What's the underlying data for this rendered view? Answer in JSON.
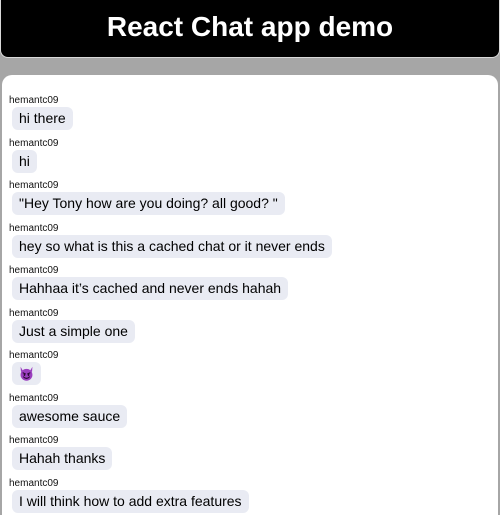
{
  "header": {
    "title": "React Chat app demo"
  },
  "messages": [
    {
      "author": "hemantc09",
      "text": "hi there"
    },
    {
      "author": "hemantc09",
      "text": "hi"
    },
    {
      "author": "hemantc09",
      "text": "\"Hey Tony how are you doing? all good? \""
    },
    {
      "author": "hemantc09",
      "text": "hey so what is this a cached chat or it never ends"
    },
    {
      "author": "hemantc09",
      "text": "Hahhaa it’s cached and never ends hahah"
    },
    {
      "author": "hemantc09",
      "text": "Just a simple one"
    },
    {
      "author": "hemantc09",
      "emoji": "😈",
      "icon": "smiling-devil-icon"
    },
    {
      "author": "hemantc09",
      "text": "awesome sauce"
    },
    {
      "author": "hemantc09",
      "text": "Hahah thanks"
    },
    {
      "author": "hemantc09",
      "text": "I will think how to add extra features"
    }
  ],
  "colors": {
    "header_bg": "#000000",
    "page_bg": "#a6a6a6",
    "bubble_bg": "#e9ebf3",
    "emoji_purple": "#9b3fbf"
  }
}
